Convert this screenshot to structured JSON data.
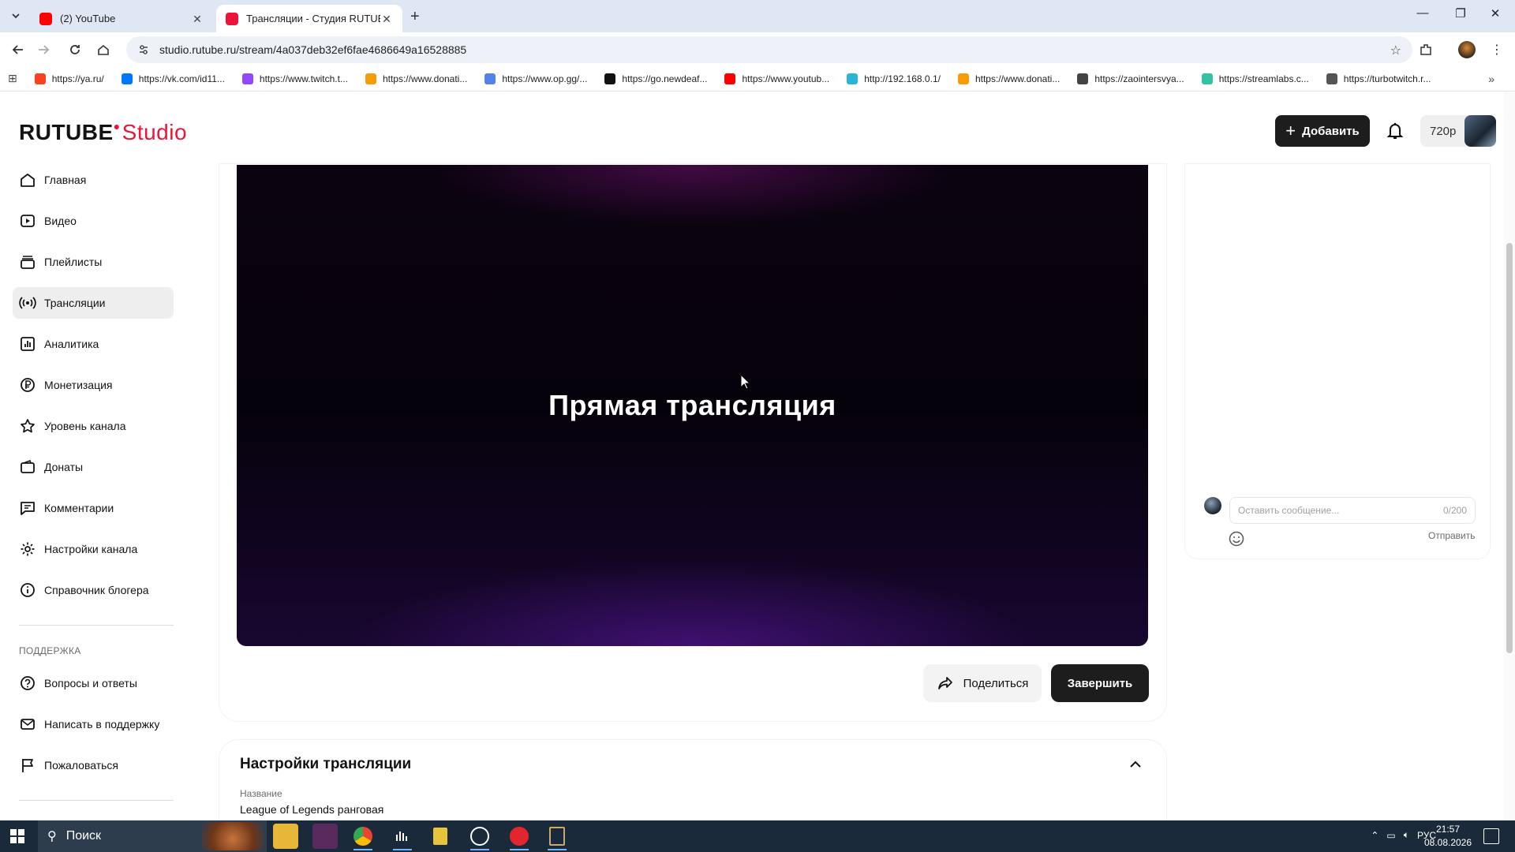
{
  "browser": {
    "tabs": [
      {
        "title": "(2) YouTube",
        "color": "#ff0000"
      },
      {
        "title": "Трансляции - Студия RUTUBE",
        "color": "#ed143b"
      }
    ],
    "url": "studio.rutube.ru/stream/4a037deb32ef6fae4686649a16528885",
    "bookmarks": [
      {
        "label": "https://ya.ru/",
        "color": "#fc3f1d"
      },
      {
        "label": "https://vk.com/id11...",
        "color": "#0077ff"
      },
      {
        "label": "https://www.twitch.t...",
        "color": "#9146ff"
      },
      {
        "label": "https://www.donati...",
        "color": "#f59c07"
      },
      {
        "label": "https://www.op.gg/...",
        "color": "#5383e8"
      },
      {
        "label": "https://go.newdeaf...",
        "color": "#111111"
      },
      {
        "label": "https://www.youtub...",
        "color": "#ff0000"
      },
      {
        "label": "http://192.168.0.1/",
        "color": "#27b6d6"
      },
      {
        "label": "https://www.donati...",
        "color": "#f59c07"
      },
      {
        "label": "https://zaointersvya...",
        "color": "#444444"
      },
      {
        "label": "https://streamlabs.c...",
        "color": "#31c3a2"
      },
      {
        "label": "https://turbotwitch.r...",
        "color": "#555555"
      }
    ]
  },
  "header": {
    "logo_main": "RUTUBE",
    "logo_studio": "Studio",
    "add_label": "Добавить",
    "quality": "720p",
    "accent": "#ed143b"
  },
  "sidebar": {
    "items": [
      {
        "label": "Главная",
        "icon": "home-icon"
      },
      {
        "label": "Видео",
        "icon": "video-icon"
      },
      {
        "label": "Плейлисты",
        "icon": "playlist-icon"
      },
      {
        "label": "Трансляции",
        "icon": "broadcast-icon",
        "active": true
      },
      {
        "label": "Аналитика",
        "icon": "analytics-icon"
      },
      {
        "label": "Монетизация",
        "icon": "ruble-icon"
      },
      {
        "label": "Уровень канала",
        "icon": "star-icon"
      },
      {
        "label": "Донаты",
        "icon": "wallet-icon"
      },
      {
        "label": "Комментарии",
        "icon": "comment-icon"
      },
      {
        "label": "Настройки канала",
        "icon": "gear-icon"
      },
      {
        "label": "Справочник блогера",
        "icon": "info-icon"
      }
    ],
    "support_heading": "ПОДДЕРЖКА",
    "support_items": [
      {
        "label": "Вопросы и ответы",
        "icon": "question-icon"
      },
      {
        "label": "Написать в поддержку",
        "icon": "mail-icon"
      },
      {
        "label": "Пожаловаться",
        "icon": "flag-icon"
      }
    ]
  },
  "player": {
    "title": "Прямая трансляция"
  },
  "actions": {
    "share_label": "Поделиться",
    "end_label": "Завершить"
  },
  "settings": {
    "title": "Настройки трансляции",
    "name_label": "Название",
    "name_value": "League of Legends ранговая"
  },
  "chat": {
    "placeholder": "Оставить сообщение...",
    "counter": "0/200",
    "send_label": "Отправить"
  },
  "taskbar": {
    "search_label": "Поиск",
    "lang": "РУС",
    "time": "21:57",
    "date": "08.08.2026"
  }
}
